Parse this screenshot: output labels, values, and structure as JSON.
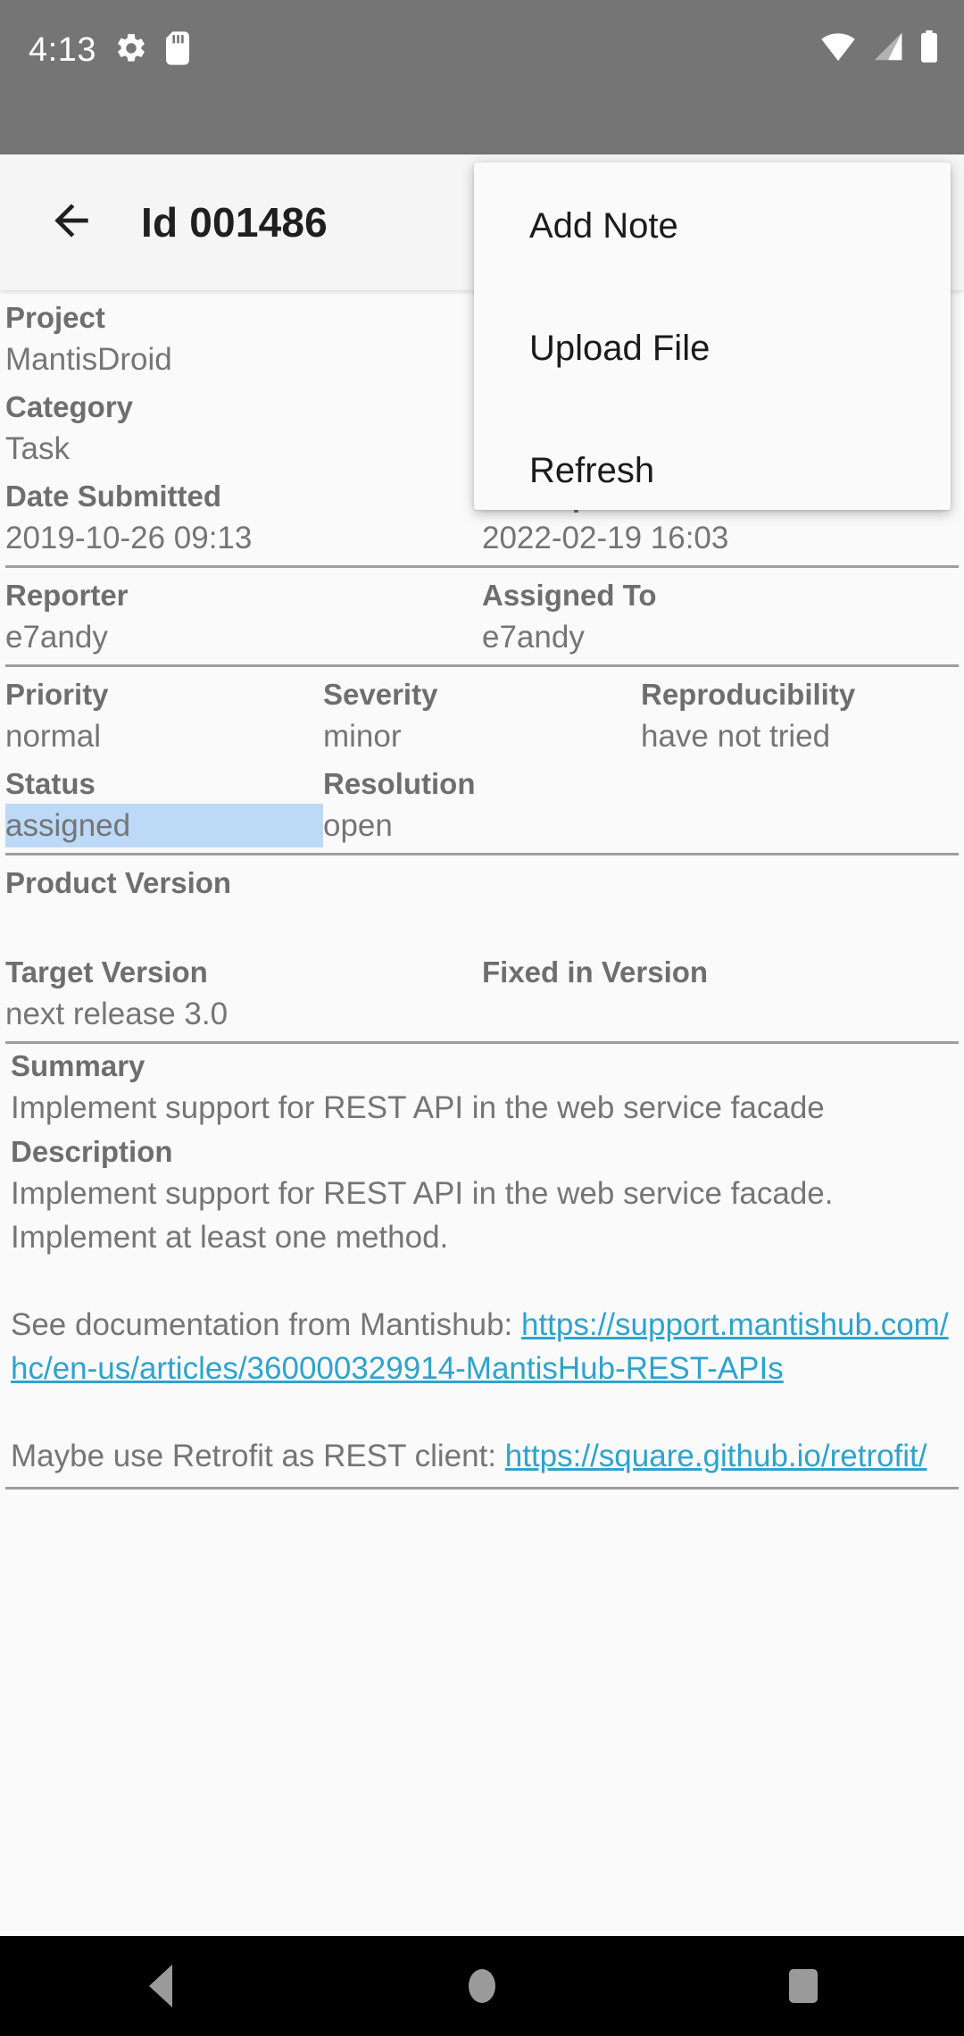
{
  "status_bar": {
    "clock": "4:13",
    "icons_left": [
      "gear-icon",
      "sd-card-icon"
    ],
    "icons_right": [
      "wifi-icon",
      "cell-signal-icon",
      "battery-icon"
    ],
    "background": "#757575"
  },
  "app_bar": {
    "back_icon": "arrow-left-icon",
    "title": "Id 001486",
    "background": "#f5f5f5"
  },
  "popup_menu": {
    "items": [
      {
        "label": "Add Note"
      },
      {
        "label": "Upload File"
      },
      {
        "label": "Refresh"
      }
    ]
  },
  "issue": {
    "rows": [
      {
        "cells": [
          {
            "label": "Project",
            "value": "MantisDroid"
          }
        ]
      },
      {
        "cells": [
          {
            "label": "Category",
            "value": "Task"
          }
        ]
      },
      {
        "cells": [
          {
            "label": "Date Submitted",
            "value": "2019-10-26 09:13"
          },
          {
            "label": "Last Update",
            "value": "2022-02-19 16:03"
          }
        ]
      },
      {
        "cells": [
          {
            "label": "Reporter",
            "value": "e7andy"
          },
          {
            "label": "Assigned To",
            "value": "e7andy"
          }
        ]
      },
      {
        "cells": [
          {
            "label": "Priority",
            "value": "normal"
          },
          {
            "label": "Severity",
            "value": "minor"
          },
          {
            "label": "Reproducibility",
            "value": "have not tried"
          }
        ]
      },
      {
        "cells": [
          {
            "label": "Status",
            "value": "assigned",
            "highlighted": true
          },
          {
            "label": "Resolution",
            "value": "open"
          }
        ]
      },
      {
        "cells": [
          {
            "label": "Product Version",
            "value": ""
          }
        ]
      },
      {
        "cells": [
          {
            "label": "Target Version",
            "value": "next release 3.0"
          },
          {
            "label": "Fixed in Version",
            "value": ""
          }
        ]
      }
    ],
    "summary": {
      "label": "Summary",
      "value": "Implement support for REST API in the web service facade"
    },
    "description": {
      "label": "Description",
      "paragraph_1": "Implement support for REST API in the web service facade. Implement at least one method.",
      "paragraph_2_prefix": "See documentation from Mantishub: ",
      "paragraph_2_link": "https://support.mantishub.com/hc/en-us/articles/360000329914-MantisHub-REST-APIs",
      "paragraph_3_prefix": "Maybe use Retrofit as REST client: ",
      "paragraph_3_link": "https://square.github.io/retrofit/"
    }
  },
  "nav_bar": {
    "back": "back-triangle-icon",
    "home": "home-circle-icon",
    "recents": "recents-square-icon"
  },
  "colors": {
    "status_bar": "#757575",
    "app_bar": "#f5f5f5",
    "content_bg": "#fafafa",
    "label": "#6e6e6e",
    "value": "#757575",
    "link": "#2fa3cc",
    "highlight": "#bcd9f7",
    "divider": "#9e9e9e",
    "nav_bar": "#000000"
  }
}
